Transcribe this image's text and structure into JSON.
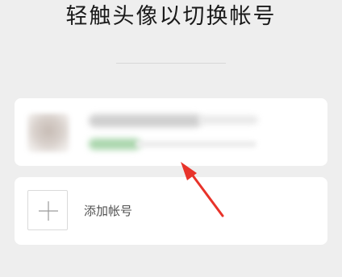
{
  "page": {
    "title": "轻触头像以切换帐号"
  },
  "account": {
    "name": "",
    "status": ""
  },
  "add_account": {
    "label": "添加帐号"
  },
  "colors": {
    "background": "#eeeeee",
    "card": "#ffffff",
    "annotation_arrow": "#e8332a",
    "status_green": "#aad6ad"
  },
  "icons": {
    "add": "plus-icon",
    "annotation": "red-arrow-icon"
  }
}
